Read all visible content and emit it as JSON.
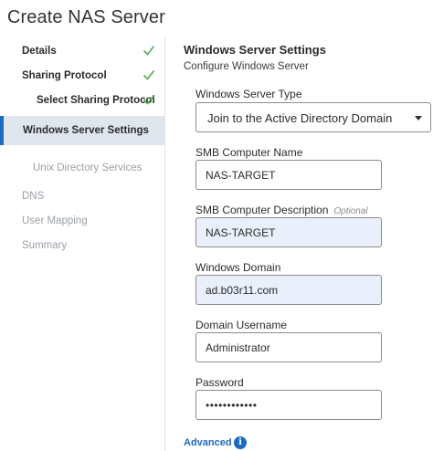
{
  "page": {
    "title": "Create NAS Server"
  },
  "sidebar": {
    "items": [
      {
        "label": "Details",
        "state": "done"
      },
      {
        "label": "Sharing Protocol",
        "state": "done"
      },
      {
        "label": "Select Sharing Protocol",
        "state": "done"
      },
      {
        "label": "Windows Server Settings",
        "state": "active"
      },
      {
        "label": "Unix Directory Services",
        "state": "pending"
      },
      {
        "label": "DNS",
        "state": "pending"
      },
      {
        "label": "User Mapping",
        "state": "pending"
      },
      {
        "label": "Summary",
        "state": "pending"
      }
    ]
  },
  "main": {
    "title": "Windows Server Settings",
    "subtitle": "Configure Windows Server",
    "server_type": {
      "label": "Windows Server Type",
      "value": "Join to the Active Directory Domain"
    },
    "smb_name": {
      "label": "SMB Computer Name",
      "value": "NAS-TARGET"
    },
    "smb_desc": {
      "label": "SMB Computer Description",
      "optional": "Optional",
      "value": "NAS-TARGET"
    },
    "domain": {
      "label": "Windows Domain",
      "value": "ad.b03r11.com"
    },
    "username": {
      "label": "Domain Username",
      "value": "Administrator"
    },
    "password": {
      "label": "Password",
      "value": "••••••••••••"
    },
    "advanced": "Advanced",
    "info_icon": "i"
  },
  "colors": {
    "accent": "#1b6ac6",
    "check": "#4caf50",
    "active_bg": "#dfe6ee",
    "filled_bg": "#e9f0fb"
  }
}
